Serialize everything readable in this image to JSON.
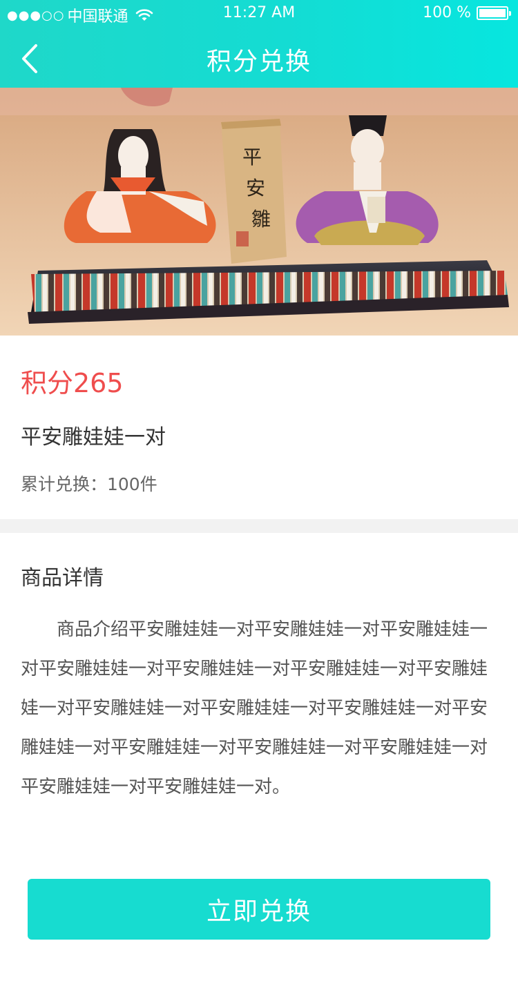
{
  "status_bar": {
    "carrier": "中国联通",
    "time": "11:27 AM",
    "battery": "100 %"
  },
  "nav": {
    "title": "积分兑换"
  },
  "product": {
    "points": "积分265",
    "name": "平安雕娃娃一对",
    "exchanged": "累计兑换：100件",
    "image_sign_text": "平安雛"
  },
  "details": {
    "title": "商品详情",
    "text": "商品介绍平安雕娃娃一对平安雕娃娃一对平安雕娃娃一对平安雕娃娃一对平安雕娃娃一对平安雕娃娃一对平安雕娃娃一对平安雕娃娃一对平安雕娃娃一对平安雕娃娃一对平安雕娃娃一对平安雕娃娃一对平安雕娃娃一对平安雕娃娃一对平安雕娃娃一对平安雕娃娃一对。"
  },
  "actions": {
    "exchange_label": "立即兑换"
  },
  "colors": {
    "accent": "#17dcd0",
    "points_red": "#ef4d4d"
  }
}
